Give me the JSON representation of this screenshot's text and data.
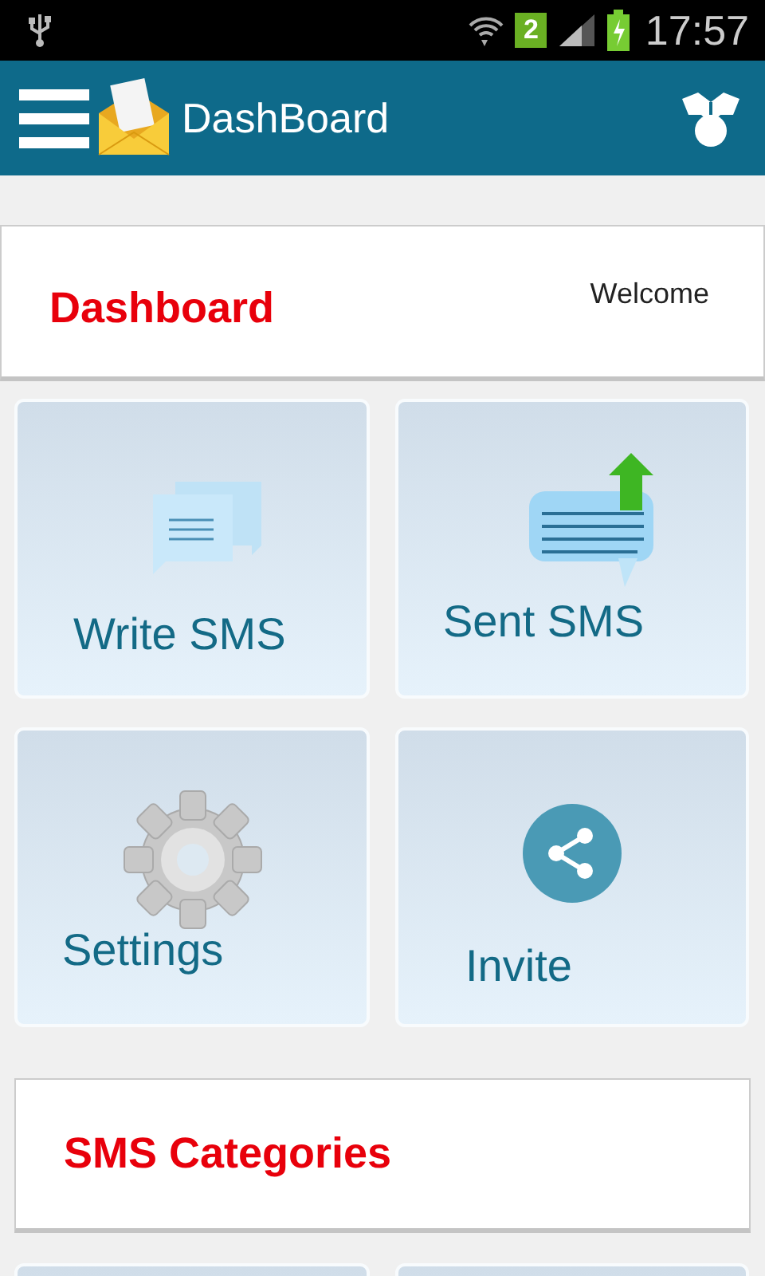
{
  "status_bar": {
    "sim_slot": "2",
    "time": "17:57"
  },
  "app_bar": {
    "title": "DashBoard"
  },
  "header_card": {
    "title": "Dashboard",
    "welcome": "Welcome"
  },
  "tiles": [
    {
      "kind": "write",
      "label": "Write SMS"
    },
    {
      "kind": "sent",
      "label": "Sent SMS"
    },
    {
      "kind": "settings",
      "label": "Settings"
    },
    {
      "kind": "invite",
      "label": "Invite"
    }
  ],
  "categories_card": {
    "title": "SMS Categories"
  }
}
